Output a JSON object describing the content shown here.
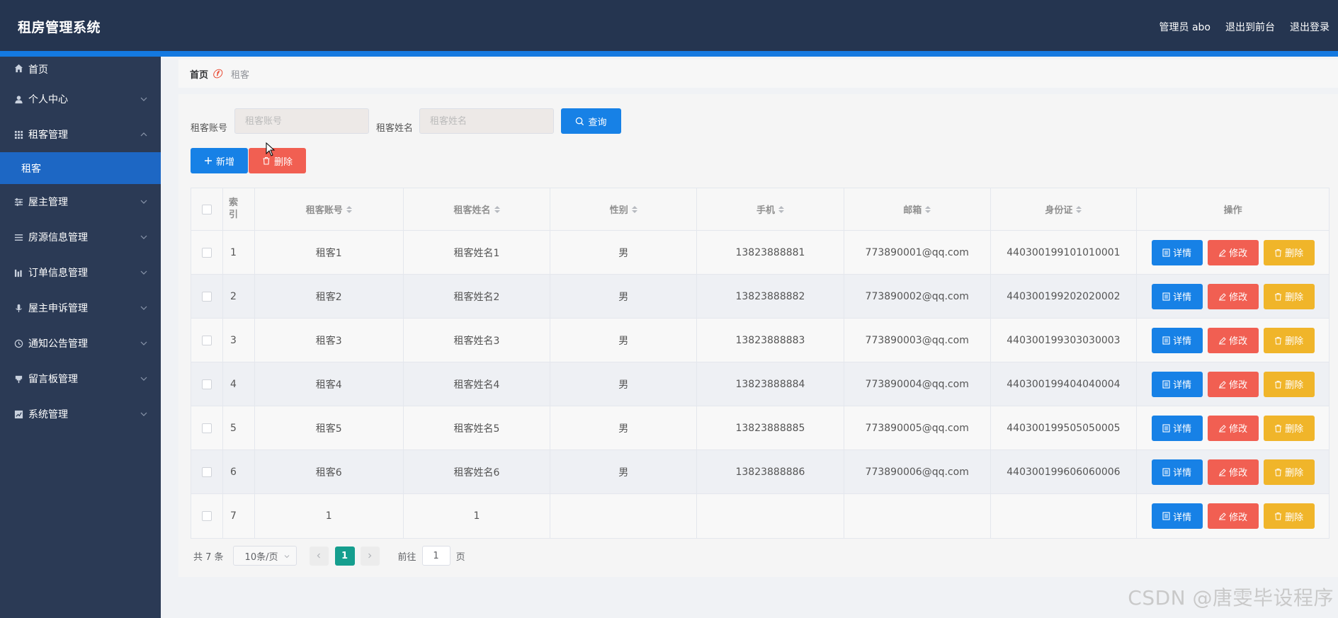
{
  "header": {
    "title": "租房管理系统",
    "user_label": "管理员 abo",
    "back_front": "退出到前台",
    "logout": "退出登录"
  },
  "sidebar": {
    "items": [
      {
        "label": "首页",
        "icon": "home-icon"
      },
      {
        "label": "个人中心",
        "icon": "user-icon"
      },
      {
        "label": "租客管理",
        "icon": "grid-icon"
      },
      {
        "label": "租客",
        "icon": ""
      },
      {
        "label": "屋主管理",
        "icon": "sliders-icon"
      },
      {
        "label": "房源信息管理",
        "icon": "list-icon"
      },
      {
        "label": "订单信息管理",
        "icon": "chart-icon"
      },
      {
        "label": "屋主申诉管理",
        "icon": "mic-icon"
      },
      {
        "label": "通知公告管理",
        "icon": "clock-icon"
      },
      {
        "label": "留言板管理",
        "icon": "pin-icon"
      },
      {
        "label": "系统管理",
        "icon": "chart-line-icon"
      }
    ]
  },
  "breadcrumb": {
    "home": "首页",
    "current": "租客"
  },
  "search": {
    "account_label": "租客账号",
    "account_placeholder": "租客账号",
    "name_label": "租客姓名",
    "name_placeholder": "租客姓名",
    "query_button": "查询"
  },
  "actions": {
    "add": "新增",
    "delete": "删除"
  },
  "table": {
    "columns": [
      "索引",
      "租客账号",
      "租客姓名",
      "性别",
      "手机",
      "邮箱",
      "身份证",
      "操作"
    ],
    "rows": [
      {
        "index": "1",
        "account": "租客1",
        "name": "租客姓名1",
        "gender": "男",
        "phone": "13823888881",
        "email": "773890001@qq.com",
        "id_card": "440300199101010001"
      },
      {
        "index": "2",
        "account": "租客2",
        "name": "租客姓名2",
        "gender": "男",
        "phone": "13823888882",
        "email": "773890002@qq.com",
        "id_card": "440300199202020002"
      },
      {
        "index": "3",
        "account": "租客3",
        "name": "租客姓名3",
        "gender": "男",
        "phone": "13823888883",
        "email": "773890003@qq.com",
        "id_card": "440300199303030003"
      },
      {
        "index": "4",
        "account": "租客4",
        "name": "租客姓名4",
        "gender": "男",
        "phone": "13823888884",
        "email": "773890004@qq.com",
        "id_card": "440300199404040004"
      },
      {
        "index": "5",
        "account": "租客5",
        "name": "租客姓名5",
        "gender": "男",
        "phone": "13823888885",
        "email": "773890005@qq.com",
        "id_card": "440300199505050005"
      },
      {
        "index": "6",
        "account": "租客6",
        "name": "租客姓名6",
        "gender": "男",
        "phone": "13823888886",
        "email": "773890006@qq.com",
        "id_card": "440300199606060006"
      },
      {
        "index": "7",
        "account": "1",
        "name": "1",
        "gender": "",
        "phone": "",
        "email": "",
        "id_card": ""
      }
    ],
    "op_detail": "详情",
    "op_edit": "修改",
    "op_delete": "删除"
  },
  "pagination": {
    "total": "共 7 条",
    "page_size": "10条/页",
    "current_page": "1",
    "goto_prefix": "前往",
    "goto_value": "1",
    "goto_suffix": "页"
  },
  "watermark": "CSDN @唐雯毕设程序",
  "colors": {
    "header_bg": "#253550",
    "sidebar_bg": "#2b3a55",
    "sidebar_active": "#1d67c4",
    "primary": "#1781e6",
    "danger": "#f15f52",
    "warning": "#f0b52a",
    "pager_active": "#159e8e"
  }
}
